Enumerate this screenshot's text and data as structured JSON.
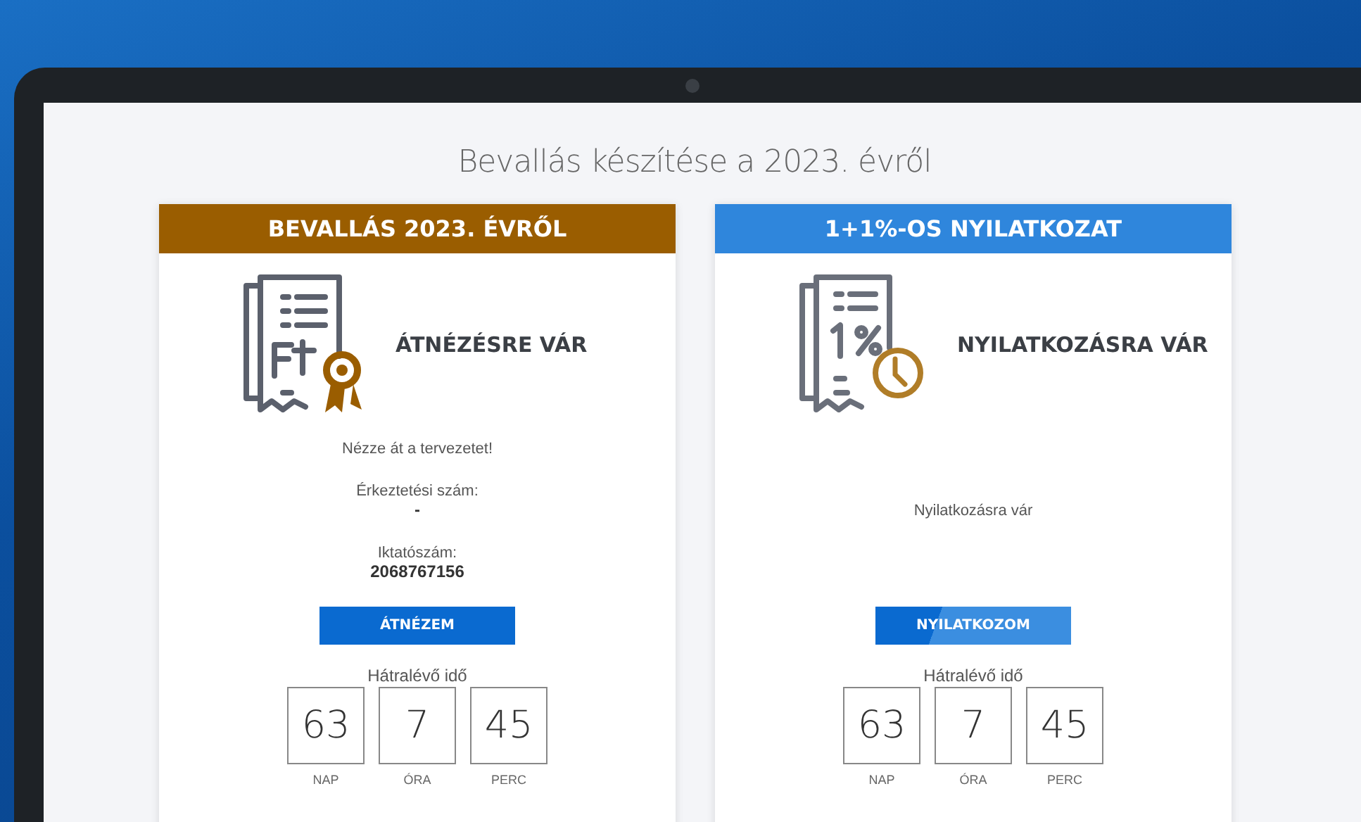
{
  "page_title": "Bevallás készítése a 2023. évről",
  "cards": [
    {
      "kind": "tax_return",
      "header": "BEVALLÁS 2023. ÉVRŐL",
      "status": "ÁTNÉZÉSRE VÁR",
      "lines": [
        {
          "kind": "message",
          "text": "Nézze át a tervezetet!"
        },
        {
          "kind": "label",
          "text": "Érkeztetési szám:"
        },
        {
          "kind": "value",
          "text": "-"
        },
        {
          "kind": "label",
          "text": "Iktatószám:"
        },
        {
          "kind": "value",
          "text": "2068767156"
        }
      ],
      "button": "ÁTNÉZEM",
      "remaining_label": "Hátralévő idő",
      "countdown": [
        {
          "value": "63",
          "unit": "NAP"
        },
        {
          "value": "7",
          "unit": "ÓRA"
        },
        {
          "value": "45",
          "unit": "PERC"
        }
      ]
    },
    {
      "kind": "declaration",
      "header": "1+1%-OS NYILATKOZAT",
      "status": "NYILATKOZÁSRA VÁR",
      "lines": [
        {
          "kind": "message",
          "text": "Nyilatkozásra vár"
        }
      ],
      "button": "NYILATKOZOM",
      "remaining_label": "Hátralévő idő",
      "countdown": [
        {
          "value": "63",
          "unit": "NAP"
        },
        {
          "value": "7",
          "unit": "ÓRA"
        },
        {
          "value": "45",
          "unit": "PERC"
        }
      ]
    }
  ]
}
